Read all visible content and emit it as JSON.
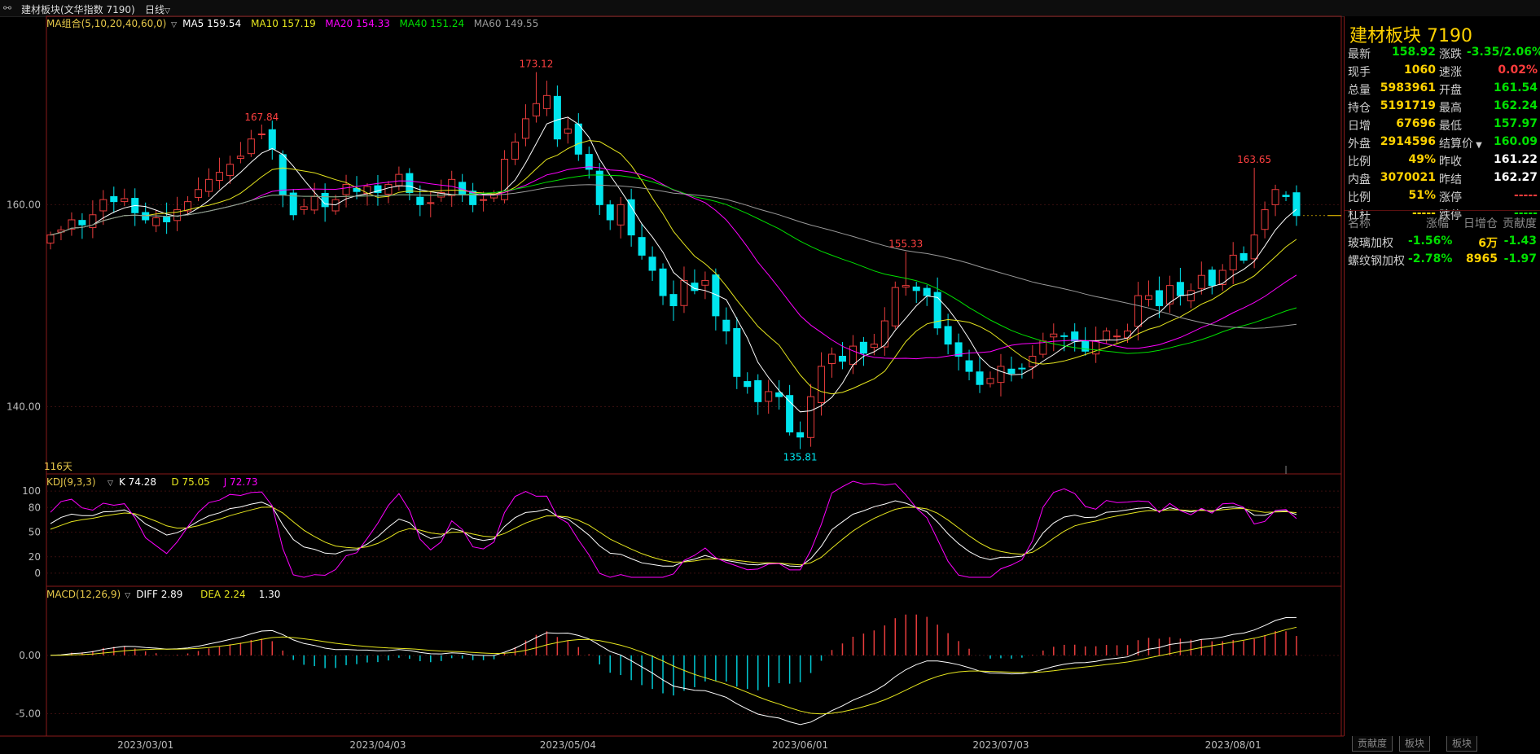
{
  "titlebar": {
    "icon": "link-icon",
    "title": "建材板块(文华指数 7190)",
    "period": "日线"
  },
  "indicators": {
    "ma": {
      "name": "MA组合(5,10,20,40,60,0)",
      "items": [
        {
          "label": "MA5 159.54",
          "color": "#ffffff"
        },
        {
          "label": "MA10 157.19",
          "color": "#e6e61e"
        },
        {
          "label": "MA20 154.33",
          "color": "#ff00ff"
        },
        {
          "label": "MA40 151.24",
          "color": "#00e000"
        },
        {
          "label": "MA60 149.55",
          "color": "#9a9a9a"
        }
      ]
    },
    "kdj": {
      "name": "KDJ(9,3,3)",
      "items": [
        {
          "label": "K 74.28",
          "color": "#ffffff"
        },
        {
          "label": "D 75.05",
          "color": "#e6e61e"
        },
        {
          "label": "J 72.73",
          "color": "#ff00ff"
        }
      ]
    },
    "macd": {
      "name": "MACD(12,26,9)",
      "items": [
        {
          "label": "DIFF 2.89",
          "color": "#ffffff"
        },
        {
          "label": "DEA 2.24",
          "color": "#e6e61e"
        },
        {
          "label": "1.30",
          "color": "#ffffff"
        }
      ]
    },
    "days_label": "116天"
  },
  "chart_data": [
    {
      "type": "candlestick",
      "ylim": [
        134,
        178
      ],
      "ytick_labels": [
        "160.00",
        "140.00"
      ],
      "yticks": [
        160,
        140
      ],
      "annotations": [
        {
          "text": "167.84",
          "index": 20,
          "value": 167.84
        },
        {
          "text": "173.12",
          "index": 46,
          "value": 173.12
        },
        {
          "text": "135.81",
          "index": 71,
          "value": 135.81
        },
        {
          "text": "155.33",
          "index": 81,
          "value": 155.33
        },
        {
          "text": "163.65",
          "index": 114,
          "value": 163.65
        }
      ],
      "xtick_labels": [
        "2023/03/01",
        "2023/04/03",
        "2023/05/04",
        "2023/06/01",
        "2023/07/03",
        "2023/08/01"
      ],
      "xtick_index": [
        9,
        31,
        49,
        71,
        90,
        112
      ],
      "last_price": 158.92,
      "close": [
        157.0,
        157.5,
        158.5,
        158.0,
        159.0,
        160.5,
        160.3,
        160.6,
        159.2,
        158.5,
        158.7,
        158.3,
        159.5,
        160.3,
        161.5,
        162.5,
        163.2,
        164.0,
        164.8,
        166.5,
        167.0,
        165.5,
        161.0,
        159.0,
        159.8,
        160.8,
        159.8,
        160.5,
        162.0,
        161.3,
        161.8,
        161.2,
        162.0,
        163.0,
        161.2,
        160.0,
        160.2,
        161.2,
        162.5,
        161.0,
        160.0,
        160.5,
        161.0,
        164.5,
        166.2,
        168.5,
        170.0,
        170.8,
        166.5,
        167.5,
        165.0,
        163.5,
        160.0,
        158.5,
        160.0,
        157.0,
        155.0,
        153.5,
        151.0,
        150.0,
        152.5,
        151.5,
        152.5,
        149.0,
        147.5,
        143.0,
        142.0,
        140.5,
        141.5,
        141.0,
        137.5,
        137.0,
        141.0,
        144.0,
        145.2,
        144.5,
        146.0,
        145.3,
        146.2,
        148.5,
        151.8,
        152.0,
        151.5,
        151.0,
        147.8,
        146.2,
        145.0,
        143.5,
        142.2,
        142.8,
        144.0,
        143.3,
        143.8,
        145.0,
        146.5,
        147.2,
        147.0,
        146.5,
        145.5,
        146.5,
        147.5,
        147.0,
        147.5,
        151.0,
        151.0,
        150.0,
        152.0,
        151.0,
        151.5,
        153.0,
        152.0,
        153.5,
        155.0,
        154.5,
        157.0,
        159.5,
        161.5,
        160.8,
        158.92
      ],
      "series": [
        {
          "name": "MA5",
          "color": "#ffffff"
        },
        {
          "name": "MA10",
          "color": "#e6e61e"
        },
        {
          "name": "MA20",
          "color": "#ff00ff"
        },
        {
          "name": "MA40",
          "color": "#00e000"
        },
        {
          "name": "MA60",
          "color": "#9a9a9a"
        }
      ]
    },
    {
      "type": "line",
      "ylim": [
        -10,
        115
      ],
      "ytick_labels": [
        "100",
        "80",
        "50",
        "20",
        "0"
      ],
      "yticks": [
        100,
        80,
        50,
        20,
        0
      ],
      "series": [
        {
          "name": "K",
          "color": "#ffffff"
        },
        {
          "name": "D",
          "color": "#e6e61e"
        },
        {
          "name": "J",
          "color": "#ff00ff"
        }
      ]
    },
    {
      "type": "bar+line",
      "ylim": [
        -6.5,
        5.5
      ],
      "ytick_labels": [
        "0.00",
        "-5.00"
      ],
      "yticks": [
        0,
        -5
      ],
      "series": [
        {
          "name": "DIFF",
          "color": "#ffffff"
        },
        {
          "name": "DEA",
          "color": "#e6e61e"
        },
        {
          "name": "MACD",
          "color": "#e83c3c"
        }
      ]
    }
  ],
  "quote": {
    "title": "建材板块  7190",
    "rows": [
      {
        "l1": "最新",
        "v1": "158.92",
        "c1": "#00e000",
        "l2": "涨跌",
        "v2": "-3.35/2.06%",
        "c2": "#00e000"
      },
      {
        "l1": "现手",
        "v1": "1060",
        "c1": "#ffd200",
        "l2": "速涨",
        "v2": "0.02%",
        "c2": "#ff3c3c"
      },
      {
        "l1": "总量",
        "v1": "5983961",
        "c1": "#ffd200",
        "l2": "开盘",
        "v2": "161.54",
        "c2": "#00e000"
      },
      {
        "l1": "持仓",
        "v1": "5191719",
        "c1": "#ffd200",
        "l2": "最高",
        "v2": "162.24",
        "c2": "#00e000"
      },
      {
        "l1": "日增",
        "v1": "67696",
        "c1": "#ffd200",
        "l2": "最低",
        "v2": "157.97",
        "c2": "#00e000"
      },
      {
        "l1": "外盘",
        "v1": "2914596",
        "c1": "#ffd200",
        "l2": "结算价",
        "v2": "160.09",
        "c2": "#00e000",
        "dropdown": true
      },
      {
        "l1": "比例",
        "v1": "49%",
        "c1": "#ffd200",
        "l2": "昨收",
        "v2": "161.22",
        "c2": "#ffffff"
      },
      {
        "l1": "内盘",
        "v1": "3070021",
        "c1": "#ffd200",
        "l2": "昨结",
        "v2": "162.27",
        "c2": "#ffffff"
      },
      {
        "l1": "比例",
        "v1": "51%",
        "c1": "#ffd200",
        "l2": "涨停",
        "v2": "-----",
        "c2": "#ff3c3c"
      },
      {
        "l1": "杠杆",
        "v1": "-----",
        "c1": "#ffd200",
        "l2": "跌停",
        "v2": "-----",
        "c2": "#00e000"
      }
    ],
    "table_headers": [
      "名称",
      "涨幅",
      "日增仓",
      "贡献度"
    ],
    "table_rows": [
      {
        "name": "玻璃加权",
        "change": "-1.56%",
        "oi": "6万",
        "contrib": "-1.43"
      },
      {
        "name": "螺纹钢加权",
        "change": "-2.78%",
        "oi": "8965",
        "contrib": "-1.97"
      }
    ]
  },
  "tabs": [
    "贡献度",
    "板块",
    "板块"
  ]
}
